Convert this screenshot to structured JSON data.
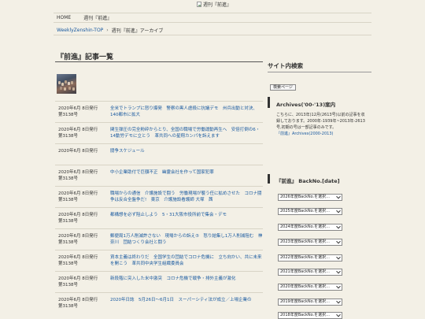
{
  "logo": {
    "alt_text": "週刊『前進』"
  },
  "topnav": {
    "items": [
      "HOME",
      "週刊『前進』"
    ]
  },
  "breadcrumb": {
    "home": "WeeklyZenshin-TOP",
    "separator": "›",
    "current": "週刊『前進』アーカイブ"
  },
  "main": {
    "title": "『前進』記事一覧",
    "articles": [
      {
        "date": "2020年6月 8日発行",
        "issue": "第3138号",
        "title": "全米でトランプに怒り爆発　警察の黒人虐殺に抗議デモ　州兵出動と対決、140都市に拡大"
      },
      {
        "date": "2020年6月 8日発行",
        "issue": "第3138号",
        "title": "関生弾圧の完全粉砕からとり、全国の職場で労働運動再生へ　安倍打倒の6・14動労デモに立とう　革共同への星翔カンパを訴えます"
      },
      {
        "date": "2020年6月 8日発行",
        "issue": "",
        "title": "闘争スケジュール"
      },
      {
        "date": "2020年6月 8日発行",
        "issue": "第3138号",
        "title": "中小企業助付で巨額不正　幽霊会社を作って国家犯罪"
      },
      {
        "date": "2020年6月 8日発行",
        "issue": "第3138号",
        "title": "職場からの通信　介護施設で闘う　労働現場が襲う任に拡めさせた　コロナ闘争は反合全盤争だ!　東京　介護施設看護師 大塚　茜"
      },
      {
        "date": "2020年6月 8日発行",
        "issue": "第3138号",
        "title": "都構想を必ず阻止しよう　5・31大阪市役所前で集会・デモ"
      },
      {
        "date": "2020年6月 8日発行",
        "issue": "第3138号",
        "title": "郵便局1万人削減許さない　現場からの訴え⑤　怒り結集し1万人削減阻む　神奈川　団結つくり会社と闘う"
      },
      {
        "date": "2020年6月 8日発行",
        "issue": "第3138号",
        "title": "資本主義は終わりだ　全国学生の団結でコロナ危機に　立ち向かい、共に未来を開こう　革共同中央学生組織委員会"
      },
      {
        "date": "2020年6月 8日発行",
        "issue": "第3138号",
        "title": "新段階に突入した米中激突　コロナ危機で戦争・排外主義が激化"
      },
      {
        "date": "2020年6月 8日発行",
        "issue": "第3138号",
        "title": "2020年日誌　5月26日～6月1日　スーパーシティ法が成立／上場企業の"
      }
    ]
  },
  "sidebar": {
    "search_heading": "サイト内検索",
    "search_button": "検索ページ",
    "archive_heading": "Archives('00-'13)案内",
    "archive_text": "こちらに、2013年)12月(2613号)以前の記事を収録しております。2000年-1939年~2013年-2613号,初期の号は一部記事のみです。",
    "archive_link": "『前進』Archives(2000-2013)",
    "backno_heading": "『前進』 BackNo.[date]",
    "backno_selects": [
      "2026年度BackNo.を選択...",
      "2025年度BackNo.を選択...",
      "2024年度BackNo.を選択...",
      "2023年度BackNo.を選択...",
      "2022年度BackNo.を選択...",
      "2021年度BackNo.を選択...",
      "2020年度BackNo.を選択...",
      "2019年度BackNo.を選択...",
      "2018年度BackNo.を選択..."
    ]
  },
  "colors": {
    "background": "#f3f0e6",
    "link": "#1a5aa0",
    "text": "#333333",
    "rule": "#d8d4c6"
  }
}
